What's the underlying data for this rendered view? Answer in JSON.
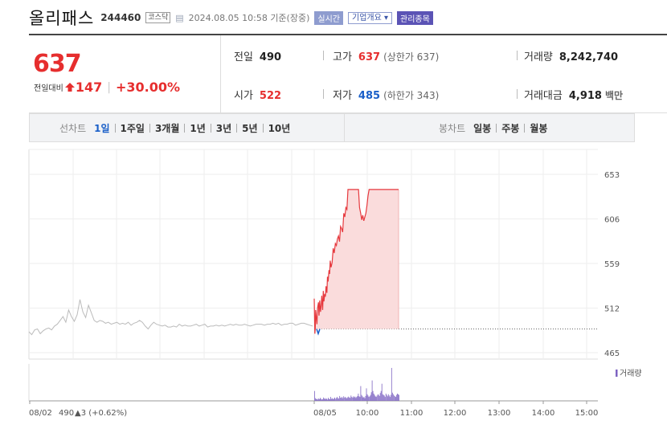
{
  "header": {
    "stock_name": "올리패스",
    "stock_code": "244460",
    "market": "코스닥",
    "timestamp": "2024.08.05 10:58 기준(장중)",
    "btn_live": "실시간",
    "btn_company": "기업개요",
    "btn_watch": "관리종목"
  },
  "quote": {
    "price": "637",
    "change_label": "전일대비",
    "change": "147",
    "change_pct": "+30.00%",
    "prev_close_label": "전일",
    "prev_close": "490",
    "open_label": "시가",
    "open": "522",
    "high_label": "고가",
    "high": "637",
    "upper_limit_text": "(상한가 637)",
    "low_label": "저가",
    "low": "485",
    "lower_limit_text": "(하한가 343)",
    "volume_label": "거래량",
    "volume": "8,242,740",
    "value_label": "거래대금",
    "value": "4,918",
    "value_unit": "백만",
    "colors": {
      "up": "#e62e2e",
      "down": "#1a5fc8"
    }
  },
  "tabs": {
    "line_label": "선차트",
    "line": [
      "1일",
      "1주일",
      "3개월",
      "1년",
      "3년",
      "5년",
      "10년"
    ],
    "line_active": 0,
    "candle_label": "봉차트",
    "candle": [
      "일봉",
      "주봉",
      "월봉"
    ]
  },
  "chart_data": {
    "type": "line",
    "y_ticks": [
      "653",
      "606",
      "559",
      "512",
      "465"
    ],
    "ylim": [
      465,
      653
    ],
    "reference_price": 490,
    "volume_legend": "거래량",
    "x_left_label": {
      "date": "08/02",
      "price": "490",
      "change": "▲3 (+0.62%)"
    },
    "x_ticks": [
      "08/05",
      "10:00",
      "11:00",
      "12:00",
      "13:00",
      "14:00",
      "15:00"
    ],
    "prev_day": {
      "x": [
        0,
        1,
        2,
        3,
        4,
        5,
        6,
        7,
        8,
        9,
        10,
        11,
        12,
        13,
        14,
        15,
        16,
        17,
        18,
        19,
        20,
        21,
        22,
        23,
        24,
        25,
        26,
        27,
        28,
        29,
        30,
        31,
        32,
        33,
        34,
        35,
        36,
        37,
        38,
        39,
        40,
        41,
        42,
        43,
        44,
        45,
        46,
        47,
        48,
        49,
        50,
        51,
        52,
        53,
        54,
        55,
        56,
        57,
        58,
        59,
        60,
        61,
        62,
        63,
        64,
        65,
        66,
        67,
        68,
        69,
        70,
        71,
        72,
        73,
        74,
        75,
        76,
        77,
        78,
        79,
        80,
        81,
        82,
        83,
        84,
        85,
        86,
        87,
        88,
        89,
        90,
        91,
        92,
        93,
        94,
        95,
        96,
        97,
        98,
        99,
        100
      ],
      "y": [
        487,
        484,
        489,
        490,
        485,
        488,
        490,
        491,
        489,
        493,
        495,
        499,
        503,
        497,
        510,
        503,
        498,
        505,
        521,
        508,
        502,
        515,
        507,
        499,
        497,
        499,
        498,
        496,
        497,
        495,
        496,
        497,
        495,
        496,
        495,
        497,
        494,
        496,
        497,
        499,
        497,
        493,
        490,
        494,
        497,
        495,
        494,
        493,
        494,
        492,
        492,
        493,
        492,
        495,
        493,
        494,
        493,
        493,
        494,
        495,
        493,
        494,
        495,
        492,
        493,
        493,
        494,
        493,
        494,
        493,
        494,
        495,
        494,
        495,
        494,
        494,
        495,
        494,
        493,
        494,
        495,
        495,
        495,
        494,
        495,
        495,
        496,
        495,
        496,
        494,
        495,
        495,
        496,
        496,
        494,
        495,
        496,
        496,
        495,
        494,
        493
      ]
    },
    "today": {
      "x": [
        0,
        0.3,
        0.5,
        0.7,
        1,
        1.3,
        1.6,
        2,
        2.3,
        2.6,
        3,
        3.3,
        3.6,
        4,
        4.3,
        4.6,
        5,
        5.3,
        5.6,
        6,
        6.3,
        6.6,
        7,
        7.3,
        7.6,
        8,
        8.5,
        9,
        9.5,
        10,
        10.5,
        11,
        11.5,
        12,
        12.5,
        13,
        13.5,
        14,
        14.5,
        15,
        15.5,
        16,
        16.5,
        17,
        17.5,
        18,
        18.5,
        19,
        19.5,
        20,
        20.5,
        21,
        21.5,
        22,
        22.5,
        23,
        23.5,
        24,
        24.5,
        25,
        25.5,
        26,
        27,
        28,
        29,
        30,
        31,
        32,
        33,
        34,
        35,
        36,
        37,
        38,
        39,
        40
      ],
      "y": [
        522,
        485,
        490,
        510,
        502,
        495,
        512,
        518,
        504,
        520,
        508,
        515,
        525,
        510,
        530,
        519,
        527,
        524,
        535,
        528,
        545,
        540,
        552,
        548,
        562,
        555,
        560,
        575,
        570,
        580,
        578,
        585,
        588,
        582,
        598,
        596,
        592,
        612,
        608,
        618,
        616,
        637,
        637,
        637,
        637,
        637,
        637,
        637,
        637,
        637,
        637,
        637,
        618,
        612,
        605,
        610,
        604,
        608,
        612,
        620,
        630,
        637,
        637,
        637,
        637,
        637,
        637,
        637,
        637,
        637,
        637,
        637,
        637,
        637,
        637,
        637
      ],
      "fill": "#fadcdc",
      "line": "#e6393e"
    },
    "volume": {
      "prev_day_total_bars": 0,
      "today_x": [
        0,
        1,
        2,
        3,
        4,
        5,
        6,
        7,
        8,
        9,
        10,
        11,
        12,
        13,
        14,
        15,
        16,
        17,
        18,
        19,
        20,
        21,
        22,
        23,
        24,
        25,
        26,
        27,
        28,
        29,
        30,
        31,
        32,
        33,
        34,
        35,
        36,
        37,
        38,
        39,
        40,
        41,
        42,
        43,
        44,
        45,
        46,
        47,
        48,
        49,
        50,
        51,
        52,
        53,
        54,
        55,
        56,
        57,
        58,
        59,
        60,
        61,
        62,
        63,
        64,
        65,
        66,
        67,
        68,
        69,
        70,
        71,
        72,
        73,
        74,
        75,
        76,
        77,
        78,
        79,
        80,
        81,
        82,
        83,
        84,
        85,
        86,
        87,
        88,
        89,
        90,
        91,
        92,
        93,
        94,
        95,
        96,
        97,
        98,
        99,
        100,
        101,
        102,
        103,
        104
      ],
      "today_v": [
        30,
        8,
        5,
        6,
        4,
        7,
        5,
        9,
        6,
        4,
        5,
        10,
        6,
        8,
        5,
        7,
        4,
        9,
        6,
        5,
        12,
        6,
        8,
        5,
        7,
        10,
        6,
        9,
        12,
        8,
        7,
        15,
        10,
        9,
        12,
        8,
        14,
        10,
        12,
        9,
        8,
        11,
        13,
        10,
        9,
        16,
        12,
        10,
        14,
        11,
        13,
        9,
        12,
        15,
        22,
        14,
        12,
        45,
        18,
        14,
        10,
        12,
        8,
        15,
        38,
        20,
        16,
        12,
        14,
        18,
        26,
        62,
        30,
        22,
        18,
        14,
        12,
        16,
        20,
        18,
        15,
        24,
        30,
        52,
        20,
        18,
        16,
        12,
        22,
        18,
        14,
        20,
        16,
        12,
        18,
        100,
        25,
        20,
        16,
        14,
        12,
        18,
        22,
        20,
        18
      ],
      "color": "#7d63c2"
    }
  }
}
